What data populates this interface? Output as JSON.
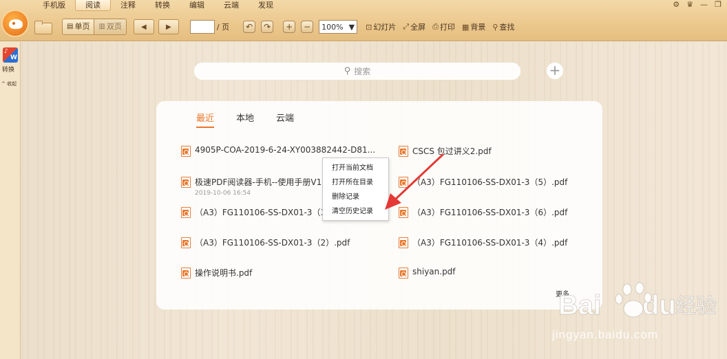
{
  "menu": {
    "items": [
      "手机版",
      "阅读",
      "注释",
      "转换",
      "编辑",
      "云端",
      "发现"
    ],
    "active_index": 1
  },
  "toolbar": {
    "single_page": "单页",
    "double_page": "双页",
    "page_value": "",
    "page_suffix": "/ 页",
    "zoom_value": "100%",
    "slideshow": "幻灯片",
    "fullscreen": "全屏",
    "print": "打印",
    "background": "背景",
    "find": "查找"
  },
  "leftrail": {
    "convert_label": "转换",
    "collapse_label": "^ 收起"
  },
  "search": {
    "placeholder": "搜索"
  },
  "tabs": [
    {
      "label": "最近",
      "active": true
    },
    {
      "label": "本地",
      "active": false
    },
    {
      "label": "云端",
      "active": false
    }
  ],
  "files": [
    {
      "name": "4905P-COA-2019-6-24-XY003882442-D81...",
      "date": ""
    },
    {
      "name": "CSCS 包过讲义2.pdf",
      "date": ""
    },
    {
      "name": "极速PDF阅读器-手机--使用手册V1",
      "date": "2019-10-06 16:54"
    },
    {
      "name": "（A3）FG110106-SS-DX01-3（5）.pdf",
      "date": ""
    },
    {
      "name": "（A3）FG110106-SS-DX01-3（3",
      "date": ""
    },
    {
      "name": "（A3）FG110106-SS-DX01-3（6）.pdf",
      "date": ""
    },
    {
      "name": "（A3）FG110106-SS-DX01-3（2）.pdf",
      "date": ""
    },
    {
      "name": "（A3）FG110106-SS-DX01-3（4）.pdf",
      "date": ""
    },
    {
      "name": "操作说明书.pdf",
      "date": ""
    },
    {
      "name": "shiyan.pdf",
      "date": ""
    }
  ],
  "more_label": "更多",
  "context_menu": {
    "items": [
      "打开当前文档",
      "打开所在目录",
      "删除记录",
      "清空历史记录"
    ]
  },
  "watermark": {
    "url": "jingyan.baidu.com"
  },
  "colors": {
    "accent": "#e9772a",
    "arrow": "#e53935"
  }
}
